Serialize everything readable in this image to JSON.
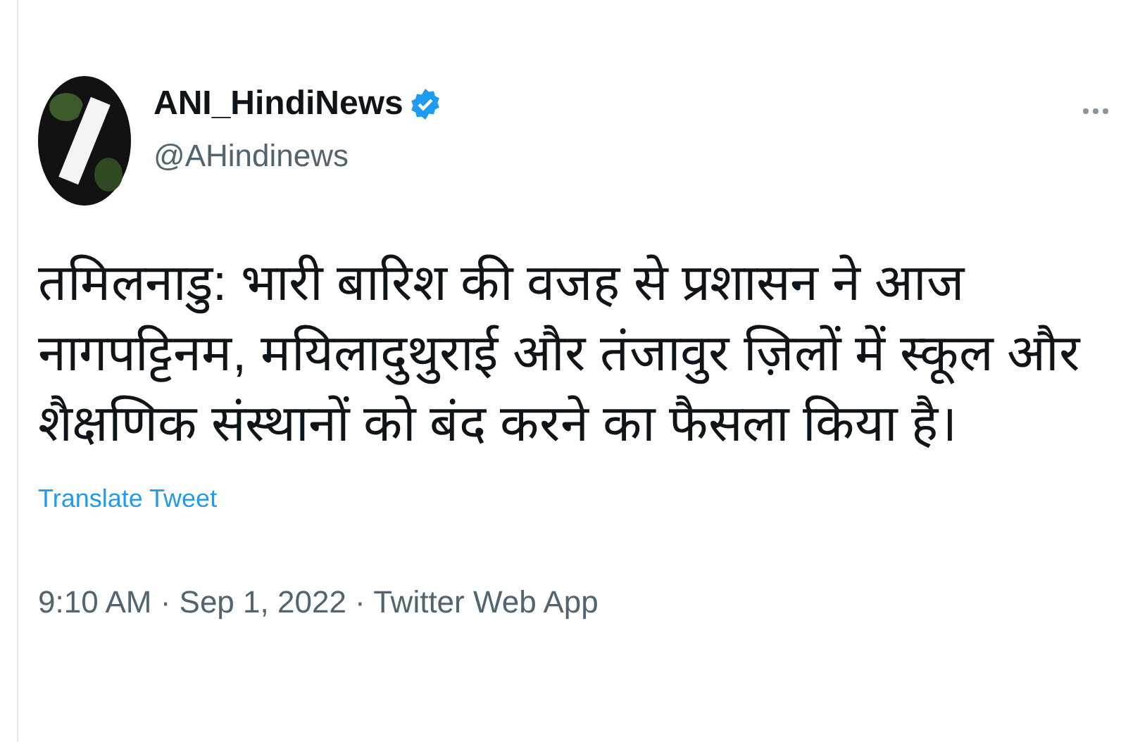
{
  "author": {
    "name": "ANI_HindiNews",
    "verified": true,
    "handle": "@AHindinews"
  },
  "text": "तमिलनाडु: भारी बारिश की वजह से प्रशासन ने आज नागपट्टिनम, मयिलादुथुराई और तंजावुर ज़िलों में स्कूल और शैक्षणिक संस्थानों को बंद करने का फैसला किया है।",
  "translate_link": "Translate Tweet",
  "meta": "9:10 AM · Sep 1, 2022 · Twitter Web App"
}
